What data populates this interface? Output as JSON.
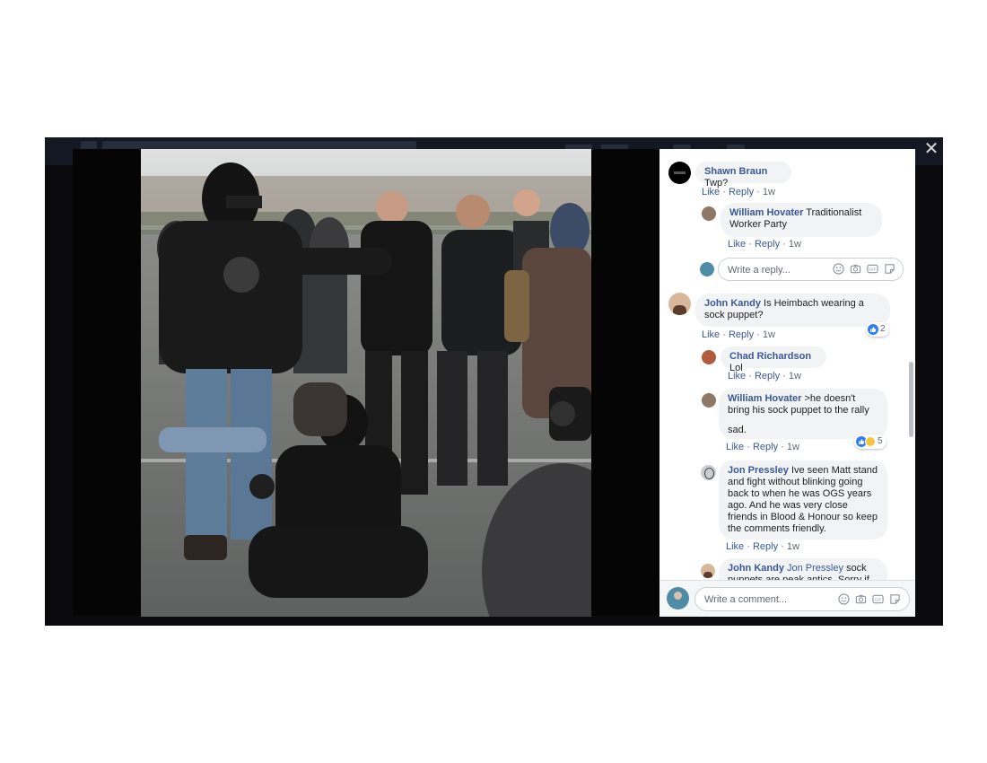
{
  "window": {
    "close_label": "✕"
  },
  "comments": [
    {
      "name": "Shawn Braun",
      "text": "Twp?",
      "like": "Like",
      "reply": "Reply",
      "time": "1w"
    },
    {
      "name": "William Hovater",
      "text": "Traditionalist Worker Party",
      "like": "Like",
      "reply": "Reply",
      "time": "1w"
    },
    {
      "name": "John Kandy",
      "text": "Is Heimbach wearing a sock puppet?",
      "like": "Like",
      "reply": "Reply",
      "time": "1w",
      "reactions": "2"
    },
    {
      "name": "Chad Richardson",
      "text": "Lol",
      "like": "Like",
      "reply": "Reply",
      "time": "1w"
    },
    {
      "name": "William Hovater",
      "text": ">he doesn't bring his sock puppet to the rally",
      "text2": "sad.",
      "like": "Like",
      "reply": "Reply",
      "time": "1w",
      "reactions": "5"
    },
    {
      "name": "Jon Pressley",
      "text": "Ive seen Matt stand and fight without blinking going back to when he was OGS years ago. And he was very close friends in Blood & Honour so keep the comments friendly.",
      "like": "Like",
      "reply": "Reply",
      "time": "1w"
    },
    {
      "name": "John Kandy",
      "mention": "Jon Pressley",
      "text": "sock puppets are peak antics. Sorry if you"
    }
  ],
  "reply_input": {
    "placeholder": "Write a reply..."
  },
  "comment_input": {
    "placeholder": "Write a comment..."
  },
  "colors": {
    "link": "#385898",
    "bubble": "#f2f3f5",
    "meta": "#606770",
    "like_blue": "#2f7df6",
    "haha_yellow": "#f7c53b"
  }
}
